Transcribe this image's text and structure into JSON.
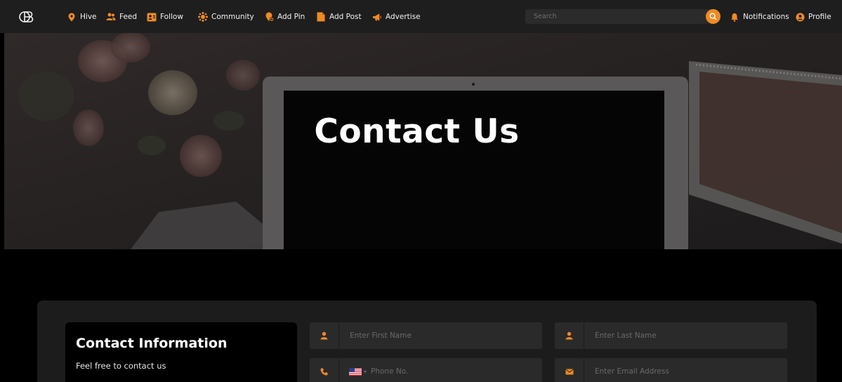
{
  "nav": {
    "items": [
      {
        "label": "Hive",
        "icon": "map-pin-icon"
      },
      {
        "label": "Feed",
        "icon": "users-icon"
      },
      {
        "label": "Follow",
        "icon": "follow-card-icon"
      },
      {
        "label": "Community",
        "icon": "community-icon"
      },
      {
        "label": "Add Pin",
        "icon": "add-pin-icon"
      },
      {
        "label": "Add Post",
        "icon": "add-post-icon"
      },
      {
        "label": "Advertise",
        "icon": "megaphone-icon"
      }
    ],
    "search_placeholder": "Search",
    "notifications_label": "Notifications",
    "profile_label": "Profile"
  },
  "hero": {
    "title": "Contact Us"
  },
  "contact": {
    "info_title": "Contact Information",
    "info_subtitle": "Feel free to contact us",
    "first_name_placeholder": "Enter First Name",
    "last_name_placeholder": "Enter Last Name",
    "phone_placeholder": "Phone No.",
    "email_placeholder": "Enter Email Address"
  },
  "colors": {
    "accent": "#f08a24",
    "navbar_bg": "#1e1e1e",
    "card_bg": "#1c1c1c",
    "field_bg": "#2a2a2a"
  }
}
